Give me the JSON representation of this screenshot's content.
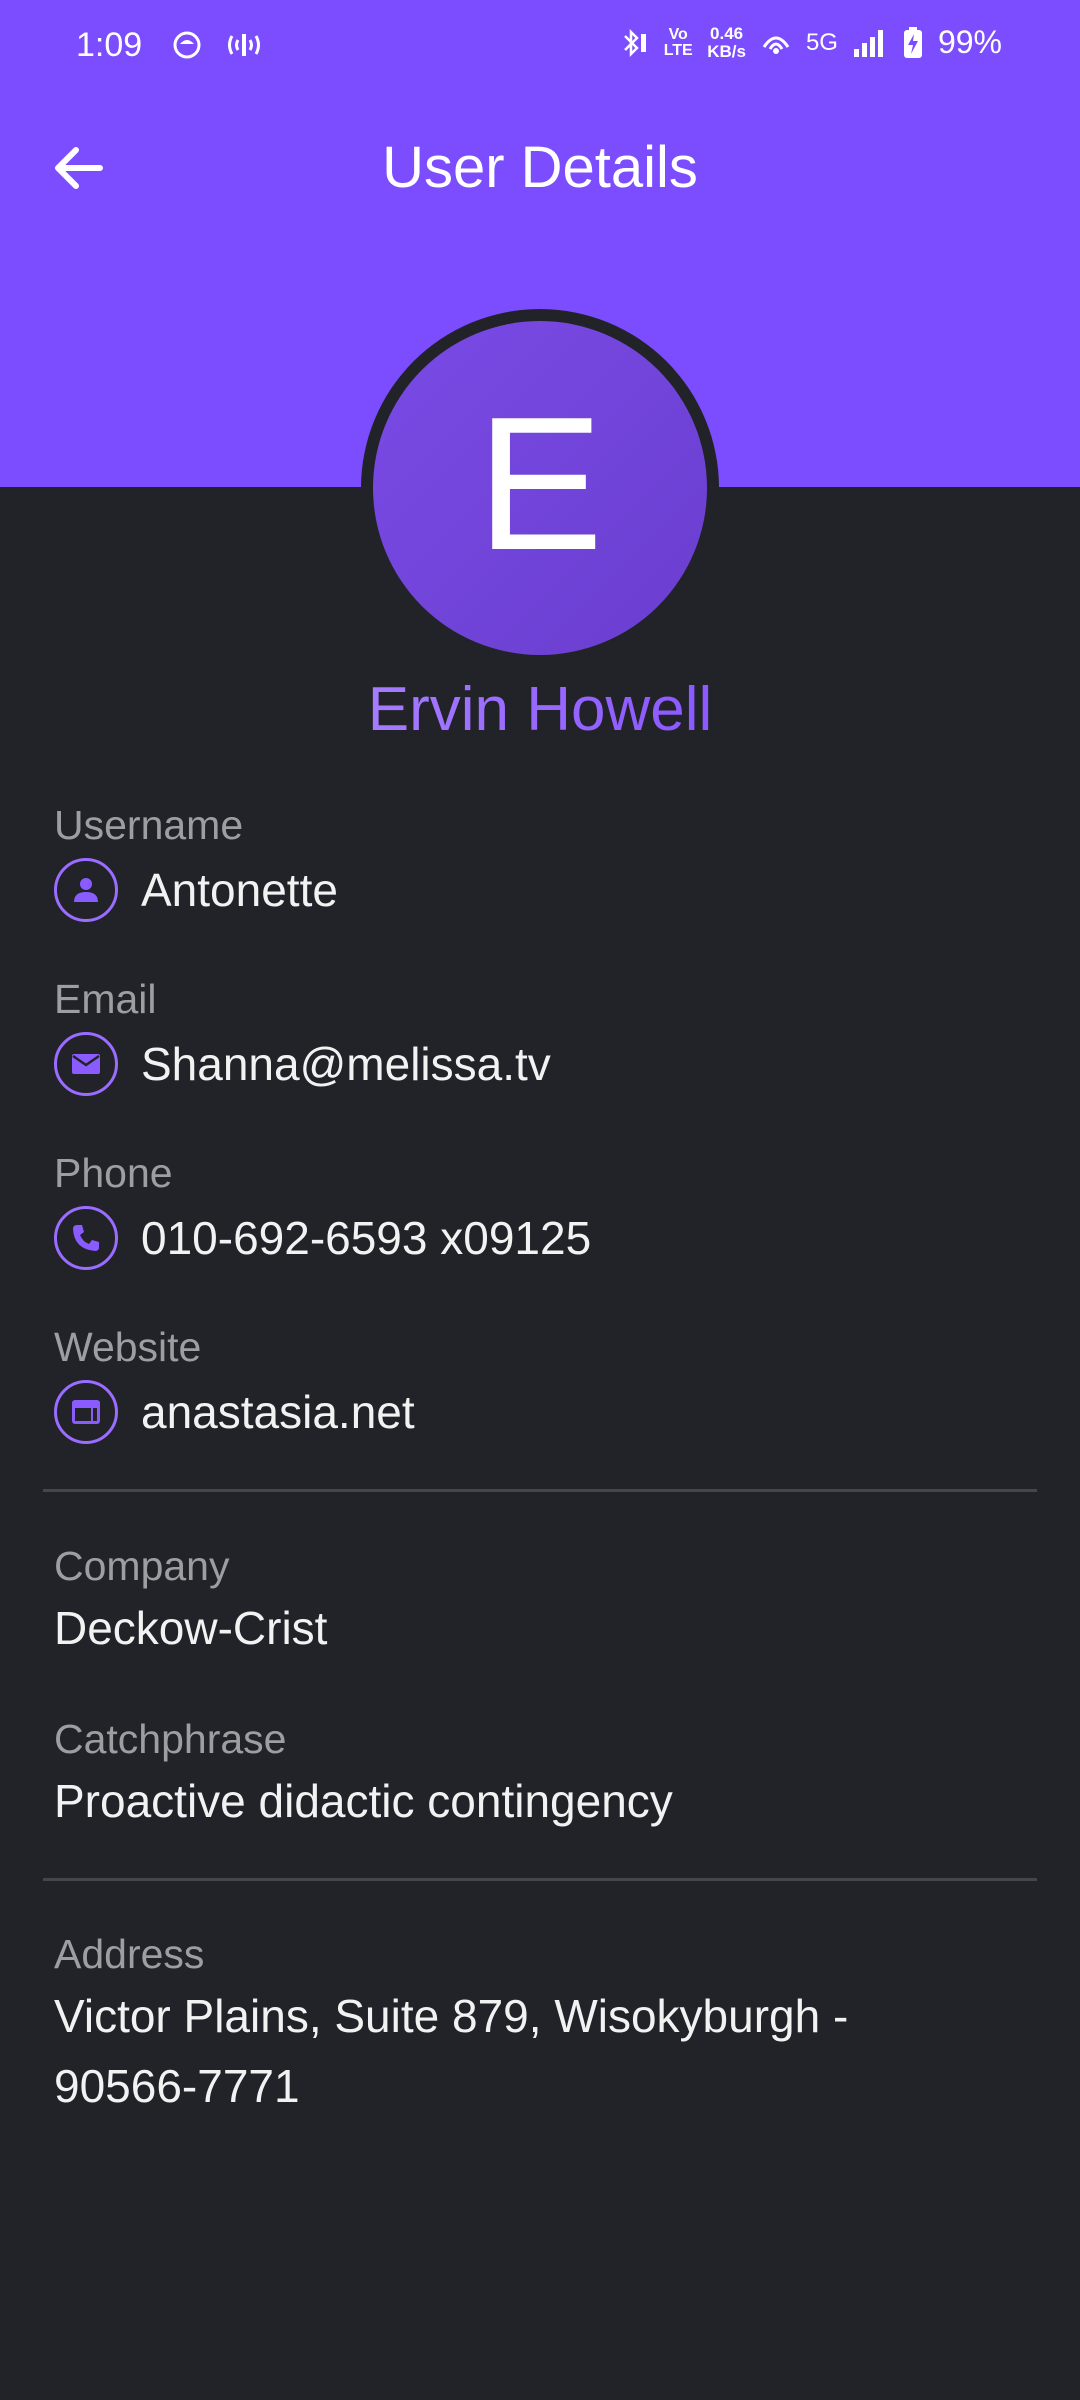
{
  "status_bar": {
    "time": "1:09",
    "volte": "Vo LTE",
    "netspeed_value": "0.46",
    "netspeed_unit": "KB/s",
    "network": "5G",
    "battery": "99%"
  },
  "app_bar": {
    "title": "User Details"
  },
  "colors": {
    "accent": "#7c4dff",
    "background": "#212328",
    "label": "#9c9ea2",
    "divider": "#44464b"
  },
  "profile": {
    "avatar_initial": "E",
    "name": "Ervin Howell"
  },
  "fields": {
    "username": {
      "label": "Username",
      "value": "Antonette",
      "icon": "person-icon"
    },
    "email": {
      "label": "Email",
      "value": "Shanna@melissa.tv",
      "icon": "mail-icon"
    },
    "phone": {
      "label": "Phone",
      "value": "010-692-6593 x09125",
      "icon": "phone-icon"
    },
    "website": {
      "label": "Website",
      "value": "anastasia.net",
      "icon": "web-icon"
    }
  },
  "company": {
    "label": "Company",
    "value": "Deckow-Crist",
    "catchphrase_label": "Catchphrase",
    "catchphrase_value": "Proactive didactic contingency"
  },
  "address": {
    "label": "Address",
    "line1": "Victor Plains, Suite 879, Wisokyburgh -",
    "line2": "90566-7771"
  }
}
